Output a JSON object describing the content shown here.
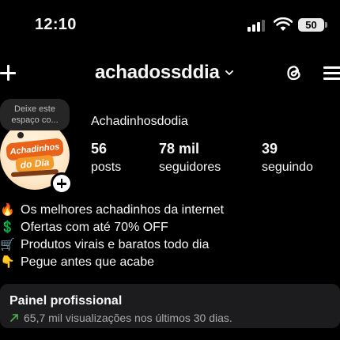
{
  "status_bar": {
    "time": "12:10",
    "battery": "50",
    "icons": [
      "signal-icon",
      "wifi-icon",
      "battery-icon"
    ]
  },
  "header": {
    "username": "achadossddia",
    "icons": [
      "plus-icon",
      "chevron-down-icon",
      "threads-icon",
      "menu-icon"
    ]
  },
  "profile": {
    "note_placeholder": "Deixe este espaço co...",
    "avatar_logo_line1": "Achadinhos",
    "avatar_logo_line2": "do Dia",
    "display_name": "Achadinhosdodia",
    "stats": [
      {
        "value": "56",
        "label": "posts"
      },
      {
        "value": "78 mil",
        "label": "seguidores"
      },
      {
        "value": "39",
        "label": "seguindo"
      }
    ]
  },
  "bio": [
    {
      "emoji": "🔥",
      "text": "Os melhores achadinhos da internet"
    },
    {
      "emoji": "💲",
      "text": "Ofertas com até 70% OFF"
    },
    {
      "emoji": "🛒",
      "text": "Produtos virais e baratos todo dia"
    },
    {
      "emoji": "👇",
      "text": "Pegue antes que acabe"
    }
  ],
  "dashboard": {
    "title": "Painel profissional",
    "subtitle": "65,7 mil visualizações nos últimos 30 dias."
  },
  "colors": {
    "background": "#000000",
    "card": "#1c1c1e",
    "trend": "#4caf50",
    "logo_orange": "#e8621a"
  }
}
